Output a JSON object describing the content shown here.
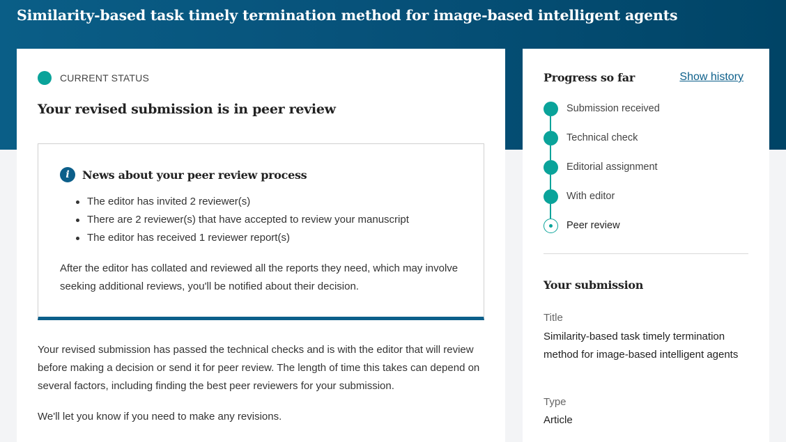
{
  "header": {
    "title": "Similarity-based task timely termination method for image-based intelligent agents",
    "color": "#07527a"
  },
  "status": {
    "label": "CURRENT STATUS",
    "heading": "Your revised submission is in peer review",
    "dot_color": "#0aa39a"
  },
  "news": {
    "icon": "info-icon",
    "title": "News about your peer review process",
    "items": [
      "The editor has invited 2 reviewer(s)",
      "There are 2 reviewer(s) that have accepted to review your manuscript",
      "The editor has received 1 reviewer report(s)"
    ],
    "paragraph": "After the editor has collated and reviewed all the reports they need, which may involve seeking additional reviews, you'll be notified about their decision."
  },
  "body": {
    "paragraph1": "Your revised submission has passed the technical checks and is with the editor that will review before making a decision or send it for peer review. The length of time this takes can depend on several factors, including finding the best peer reviewers for your submission.",
    "paragraph2": "We'll let you know if you need to make any revisions."
  },
  "progress": {
    "title": "Progress so far",
    "history_link": "Show history",
    "steps": [
      {
        "label": "Submission received",
        "state": "done"
      },
      {
        "label": "Technical check",
        "state": "done"
      },
      {
        "label": "Editorial assignment",
        "state": "done"
      },
      {
        "label": "With editor",
        "state": "done"
      },
      {
        "label": "Peer review",
        "state": "current"
      }
    ]
  },
  "submission": {
    "heading": "Your submission",
    "title_label": "Title",
    "title_value": "Similarity-based task timely termination method for image-based intelligent agents",
    "type_label": "Type",
    "type_value": "Article"
  }
}
